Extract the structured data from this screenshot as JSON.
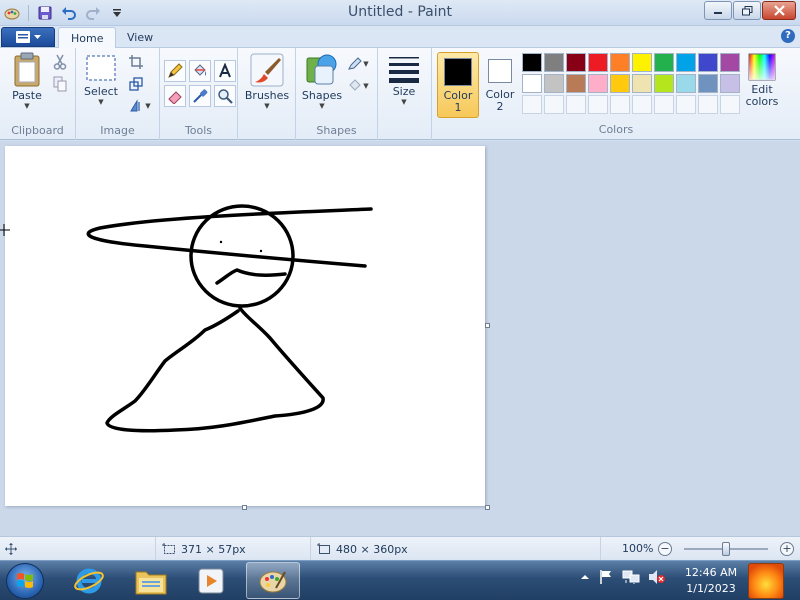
{
  "window": {
    "title": "Untitled - Paint"
  },
  "tabs": [
    {
      "label": "Home",
      "active": true
    },
    {
      "label": "View",
      "active": false
    }
  ],
  "ribbon": {
    "clipboard": {
      "group_label": "Clipboard",
      "paste_label": "Paste"
    },
    "image": {
      "group_label": "Image",
      "select_label": "Select"
    },
    "tools": {
      "group_label": "Tools"
    },
    "brushes": {
      "label": "Brushes"
    },
    "shapes": {
      "group_label": "Shapes",
      "label": "Shapes"
    },
    "size": {
      "label": "Size"
    },
    "colors": {
      "group_label": "Colors",
      "color1_label": "Color 1",
      "color1_number": "1",
      "color1_text": "Color",
      "color2_text": "Color",
      "color2_number": "2",
      "color1_value": "#000000",
      "color2_value": "#ffffff",
      "edit_label_line1": "Edit",
      "edit_label_line2": "colors",
      "palette": [
        "#000000",
        "#7f7f7f",
        "#880015",
        "#ed1c24",
        "#ff7f27",
        "#fff200",
        "#22b14c",
        "#00a2e8",
        "#3f48cc",
        "#a349a4",
        "#ffffff",
        "#c3c3c3",
        "#b97a57",
        "#ffaec9",
        "#ffc90e",
        "#efe4b0",
        "#b5e61d",
        "#99d9ea",
        "#7092be",
        "#c8bfe7",
        "",
        "",
        "",
        "",
        "",
        "",
        "",
        "",
        "",
        ""
      ]
    }
  },
  "status": {
    "selection_size": "371 × 57px",
    "canvas_size": "480 × 360px",
    "zoom": "100%",
    "zoom_level": 1.0
  },
  "taskbar": {
    "time": "12:46 AM",
    "date": "1/1/2023"
  }
}
